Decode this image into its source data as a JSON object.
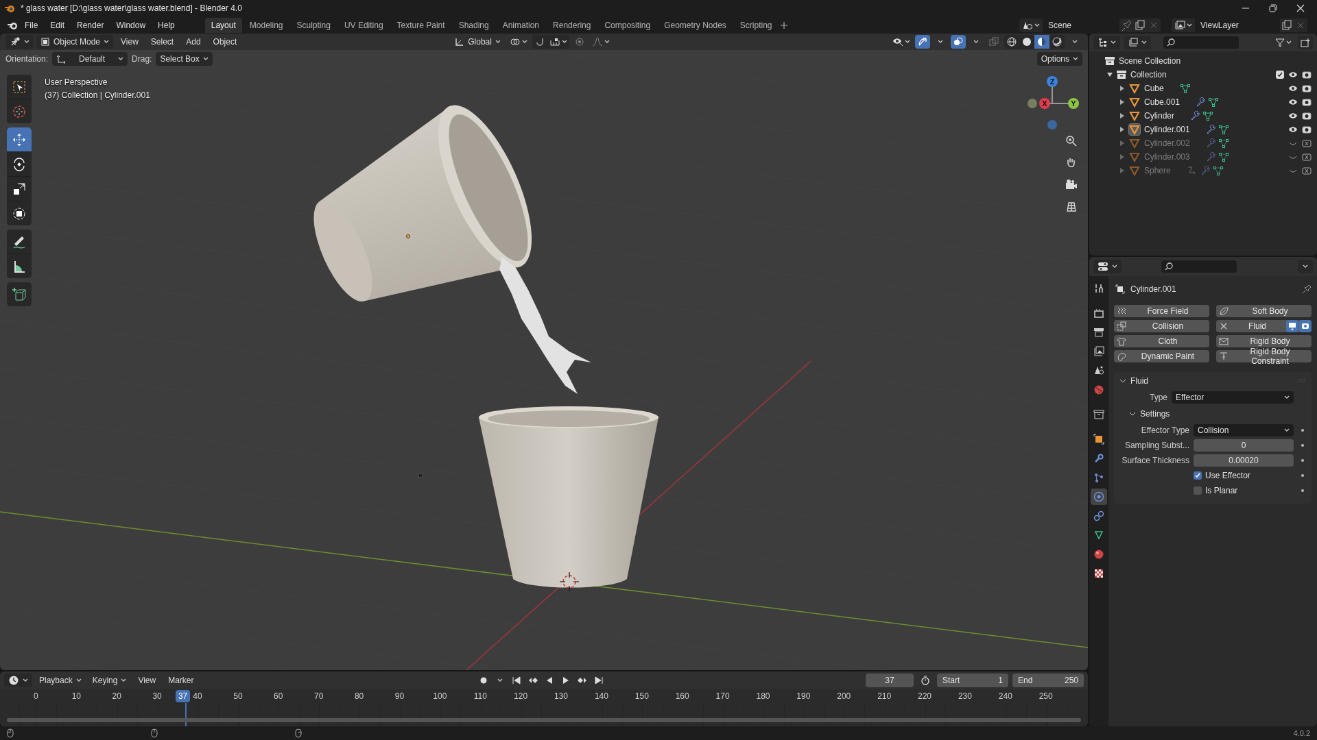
{
  "window": {
    "title": "* glass water [D:\\glass water\\glass water.blend] - Blender 4.0"
  },
  "menu": [
    "File",
    "Edit",
    "Render",
    "Window",
    "Help"
  ],
  "workspaces": [
    {
      "label": "Layout",
      "selected": true
    },
    {
      "label": "Modeling",
      "selected": false
    },
    {
      "label": "Sculpting",
      "selected": false
    },
    {
      "label": "UV Editing",
      "selected": false
    },
    {
      "label": "Texture Paint",
      "selected": false
    },
    {
      "label": "Shading",
      "selected": false
    },
    {
      "label": "Animation",
      "selected": false
    },
    {
      "label": "Rendering",
      "selected": false
    },
    {
      "label": "Compositing",
      "selected": false
    },
    {
      "label": "Geometry Nodes",
      "selected": false
    },
    {
      "label": "Scripting",
      "selected": false
    }
  ],
  "scene": {
    "name": "Scene"
  },
  "view_layer": {
    "name": "ViewLayer"
  },
  "viewport": {
    "mode": "Object Mode",
    "menus": [
      "View",
      "Select",
      "Add",
      "Object"
    ],
    "orientation": "Global",
    "gizmos_on": true,
    "overlays_on": true,
    "xray_on": false,
    "shading": [
      {
        "kind": "wireframe",
        "selected": false
      },
      {
        "kind": "solid",
        "selected": false
      },
      {
        "kind": "material",
        "selected": true
      },
      {
        "kind": "rendered",
        "selected": false
      }
    ],
    "tool_settings": {
      "orientation_label": "Orientation:",
      "orientation": "Default",
      "drag_label": "Drag:",
      "drag": "Select Box",
      "options": "Options"
    },
    "info": [
      "User Perspective",
      "(37) Collection | Cylinder.001"
    ],
    "tools": [
      {
        "kind": "select_box",
        "selected": false
      },
      {
        "kind": "cursor",
        "selected": false
      },
      {
        "kind": "move",
        "selected": true
      },
      {
        "kind": "rotate",
        "selected": false
      },
      {
        "kind": "scale",
        "selected": false
      },
      {
        "kind": "transform",
        "selected": false
      },
      {
        "kind": "annotate",
        "selected": false
      },
      {
        "kind": "measure",
        "selected": false
      },
      {
        "kind": "add_cube",
        "selected": false
      }
    ],
    "gizmo_axes": [
      "X",
      "Y",
      "Z"
    ]
  },
  "outliner": {
    "root": "Scene Collection",
    "collection": {
      "name": "Collection",
      "checked": true,
      "expanded": true,
      "children": [
        {
          "name": "Cube",
          "visible": true,
          "selected": false,
          "modifiers": false,
          "constraints": false
        },
        {
          "name": "Cube.001",
          "visible": true,
          "selected": false,
          "modifiers": true,
          "constraints": false
        },
        {
          "name": "Cylinder",
          "visible": true,
          "selected": false,
          "modifiers": true,
          "constraints": false
        },
        {
          "name": "Cylinder.001",
          "visible": true,
          "selected": true,
          "modifiers": true,
          "constraints": false
        },
        {
          "name": "Cylinder.002",
          "visible": false,
          "selected": false,
          "modifiers": true,
          "constraints": false
        },
        {
          "name": "Cylinder.003",
          "visible": false,
          "selected": false,
          "modifiers": true,
          "constraints": false
        },
        {
          "name": "Sphere",
          "visible": false,
          "selected": false,
          "modifiers": true,
          "constraints": true
        }
      ]
    }
  },
  "properties": {
    "tabs": [
      {
        "kind": "tool",
        "selected": false
      },
      {
        "kind": "render",
        "selected": false
      },
      {
        "kind": "output",
        "selected": false
      },
      {
        "kind": "view_layer",
        "selected": false
      },
      {
        "kind": "scene",
        "selected": false
      },
      {
        "kind": "world",
        "selected": false
      },
      {
        "kind": "collection",
        "selected": false
      },
      {
        "kind": "object",
        "selected": false
      },
      {
        "kind": "modifiers",
        "selected": false
      },
      {
        "kind": "particles",
        "selected": false
      },
      {
        "kind": "physics",
        "selected": true
      },
      {
        "kind": "constraints",
        "selected": false
      },
      {
        "kind": "data",
        "selected": false
      },
      {
        "kind": "material",
        "selected": false
      },
      {
        "kind": "texture",
        "selected": false
      }
    ],
    "object": "Cylinder.001",
    "physics": [
      {
        "label": "Force Field",
        "kind": "force_field",
        "enabled": false
      },
      {
        "label": "Soft Body",
        "kind": "soft_body",
        "enabled": false
      },
      {
        "label": "Collision",
        "kind": "collision",
        "enabled": false
      },
      {
        "label": "Fluid",
        "kind": "fluid",
        "enabled": true
      },
      {
        "label": "Cloth",
        "kind": "cloth",
        "enabled": false
      },
      {
        "label": "Rigid Body",
        "kind": "rigid_body",
        "enabled": false
      },
      {
        "label": "Dynamic Paint",
        "kind": "dynamic_paint",
        "enabled": false
      },
      {
        "label": "Rigid Body Constraint",
        "kind": "rigid_body_constraint",
        "enabled": false
      }
    ],
    "panel": {
      "title": "Fluid",
      "expanded": true,
      "type_label": "Type",
      "type": "Effector",
      "settings": {
        "title": "Settings",
        "expanded": true,
        "fields": [
          {
            "kind": "dropdown",
            "label": "Effector Type",
            "value": "Collision"
          },
          {
            "kind": "number",
            "label": "Sampling Subst...",
            "value": "0"
          },
          {
            "kind": "number",
            "label": "Surface Thickness",
            "value": "0.00020"
          },
          {
            "kind": "checkbox",
            "label": "Use Effector",
            "checked": true
          },
          {
            "kind": "checkbox",
            "label": "Is Planar",
            "checked": false
          }
        ]
      }
    }
  },
  "timeline": {
    "menus": [
      "Playback",
      "Keying",
      "View",
      "Marker"
    ],
    "current_frame": "37",
    "start_label": "Start",
    "start": "1",
    "end_label": "End",
    "end": "250",
    "ticks": [
      "0",
      "10",
      "20",
      "30",
      "40",
      "50",
      "60",
      "70",
      "80",
      "90",
      "100",
      "110",
      "120",
      "130",
      "140",
      "150",
      "160",
      "170",
      "180",
      "190",
      "200",
      "210",
      "220",
      "230",
      "240",
      "250"
    ],
    "playhead": "37"
  },
  "status_bar": {
    "version": "4.0.2"
  }
}
